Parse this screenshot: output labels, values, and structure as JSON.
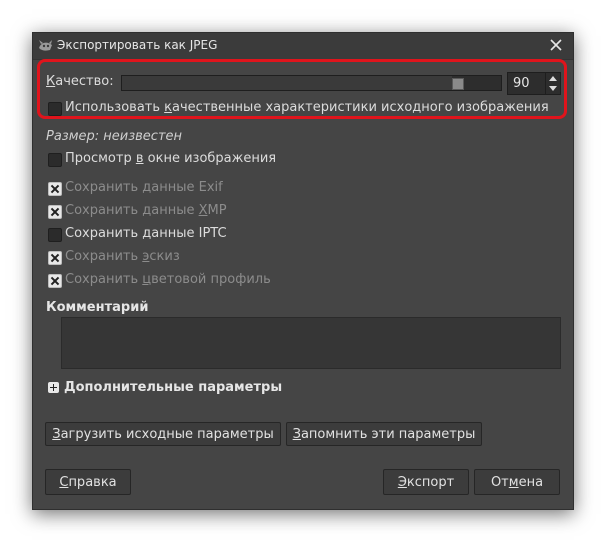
{
  "window": {
    "title": "Экспортировать как JPEG"
  },
  "quality": {
    "label_first": "К",
    "label_rest": "ачество:",
    "value": "90",
    "fraction": 0.9
  },
  "use_source_quality": {
    "prefix": "Использовать ",
    "underlined": "к",
    "suffix": "ачественные характеристики исходного изображения",
    "checked": false
  },
  "size_info": "Размер: неизвестен",
  "preview": {
    "prefix": "Просмотр ",
    "underlined": "в",
    "suffix": " окне изображения",
    "checked": false
  },
  "save_exif": {
    "label": "Сохранить данные Exif",
    "checked": true,
    "enabled": false
  },
  "save_xmp": {
    "prefix": "Сохранить данные ",
    "underlined": "X",
    "suffix": "MP",
    "checked": true,
    "enabled": false
  },
  "save_iptc": {
    "label": "Сохранить данные IPTC",
    "checked": false,
    "enabled": true
  },
  "save_thumbnail": {
    "prefix": "Сохранить ",
    "underlined": "э",
    "suffix": "скиз",
    "checked": true,
    "enabled": false
  },
  "save_color_profile": {
    "prefix": "Сохранить ",
    "underlined": "ц",
    "suffix": "ветовой профиль",
    "checked": true,
    "enabled": false
  },
  "comment": {
    "label": "Комментарий",
    "value": ""
  },
  "advanced": {
    "underlined": "Д",
    "suffix": "ополнительные параметры"
  },
  "buttons": {
    "load_defaults": {
      "underlined": "З",
      "suffix": "агрузить исходные параметры"
    },
    "save_defaults": {
      "underlined": "З",
      "suffix": "апомнить эти параметры"
    },
    "help": {
      "underlined": "С",
      "suffix": "правка"
    },
    "export": {
      "underlined": "Э",
      "suffix": "кспорт"
    },
    "cancel": {
      "prefix": "От",
      "underlined": "м",
      "suffix": "ена"
    }
  },
  "colors": {
    "highlight": "#e0141c",
    "window_bg": "#454545",
    "titlebar_bg": "#3b3b3b"
  }
}
